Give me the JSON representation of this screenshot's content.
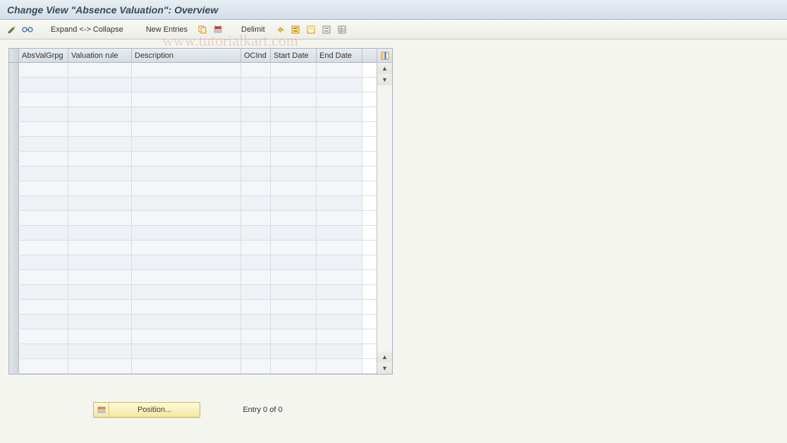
{
  "title": "Change View \"Absence Valuation\": Overview",
  "toolbar": {
    "expand_collapse": "Expand <-> Collapse",
    "new_entries": "New Entries",
    "delimit": "Delimit"
  },
  "watermark": "www.tutorialkart.com",
  "table": {
    "columns": [
      {
        "key": "absvalgrpg",
        "label": "AbsValGrpg"
      },
      {
        "key": "valuation_rule",
        "label": "Valuation rule"
      },
      {
        "key": "description",
        "label": "Description"
      },
      {
        "key": "ocind",
        "label": "OCInd"
      },
      {
        "key": "start_date",
        "label": "Start Date"
      },
      {
        "key": "end_date",
        "label": "End Date"
      }
    ],
    "rows": [
      {},
      {},
      {},
      {},
      {},
      {},
      {},
      {},
      {},
      {},
      {},
      {},
      {},
      {},
      {},
      {},
      {},
      {},
      {},
      {},
      {}
    ]
  },
  "footer": {
    "position_button": "Position...",
    "entry_status": "Entry 0 of 0"
  }
}
